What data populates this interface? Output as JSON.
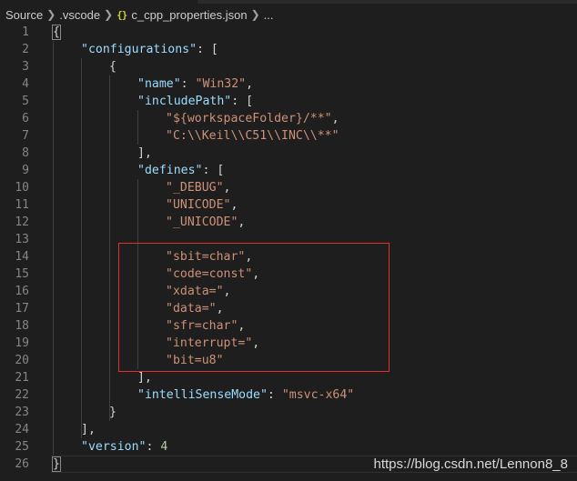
{
  "breadcrumb": {
    "items": [
      "Source",
      ".vscode",
      "c_cpp_properties.json",
      "..."
    ],
    "file_icon": "{}"
  },
  "editor": {
    "lines": [
      {
        "num": "1",
        "indent": 0,
        "tokens": [
          {
            "t": "p",
            "v": "{"
          }
        ]
      },
      {
        "num": "2",
        "indent": 1,
        "tokens": [
          {
            "t": "k",
            "v": "\"configurations\""
          },
          {
            "t": "p",
            "v": ": ["
          }
        ]
      },
      {
        "num": "3",
        "indent": 2,
        "tokens": [
          {
            "t": "p",
            "v": "{"
          }
        ]
      },
      {
        "num": "4",
        "indent": 3,
        "tokens": [
          {
            "t": "k",
            "v": "\"name\""
          },
          {
            "t": "p",
            "v": ": "
          },
          {
            "t": "s",
            "v": "\"Win32\""
          },
          {
            "t": "p",
            "v": ","
          }
        ]
      },
      {
        "num": "5",
        "indent": 3,
        "tokens": [
          {
            "t": "k",
            "v": "\"includePath\""
          },
          {
            "t": "p",
            "v": ": ["
          }
        ]
      },
      {
        "num": "6",
        "indent": 4,
        "tokens": [
          {
            "t": "s",
            "v": "\"${workspaceFolder}/**\""
          },
          {
            "t": "p",
            "v": ","
          }
        ]
      },
      {
        "num": "7",
        "indent": 4,
        "tokens": [
          {
            "t": "s",
            "v": "\"C:\\\\Keil\\\\C51\\\\INC\\\\**\""
          }
        ]
      },
      {
        "num": "8",
        "indent": 3,
        "tokens": [
          {
            "t": "p",
            "v": "],"
          }
        ]
      },
      {
        "num": "9",
        "indent": 3,
        "tokens": [
          {
            "t": "k",
            "v": "\"defines\""
          },
          {
            "t": "p",
            "v": ": ["
          }
        ]
      },
      {
        "num": "10",
        "indent": 4,
        "tokens": [
          {
            "t": "s",
            "v": "\"_DEBUG\""
          },
          {
            "t": "p",
            "v": ","
          }
        ]
      },
      {
        "num": "11",
        "indent": 4,
        "tokens": [
          {
            "t": "s",
            "v": "\"UNICODE\""
          },
          {
            "t": "p",
            "v": ","
          }
        ]
      },
      {
        "num": "12",
        "indent": 4,
        "tokens": [
          {
            "t": "s",
            "v": "\"_UNICODE\""
          },
          {
            "t": "p",
            "v": ","
          }
        ]
      },
      {
        "num": "13",
        "indent": 4,
        "tokens": []
      },
      {
        "num": "14",
        "indent": 4,
        "tokens": [
          {
            "t": "s",
            "v": "\"sbit=char\""
          },
          {
            "t": "p",
            "v": ","
          }
        ]
      },
      {
        "num": "15",
        "indent": 4,
        "tokens": [
          {
            "t": "s",
            "v": "\"code=const\""
          },
          {
            "t": "p",
            "v": ","
          }
        ]
      },
      {
        "num": "16",
        "indent": 4,
        "tokens": [
          {
            "t": "s",
            "v": "\"xdata=\""
          },
          {
            "t": "p",
            "v": ","
          }
        ]
      },
      {
        "num": "17",
        "indent": 4,
        "tokens": [
          {
            "t": "s",
            "v": "\"data=\""
          },
          {
            "t": "p",
            "v": ","
          }
        ]
      },
      {
        "num": "18",
        "indent": 4,
        "tokens": [
          {
            "t": "s",
            "v": "\"sfr=char\""
          },
          {
            "t": "p",
            "v": ","
          }
        ]
      },
      {
        "num": "19",
        "indent": 4,
        "tokens": [
          {
            "t": "s",
            "v": "\"interrupt=\""
          },
          {
            "t": "p",
            "v": ","
          }
        ]
      },
      {
        "num": "20",
        "indent": 4,
        "tokens": [
          {
            "t": "s",
            "v": "\"bit=u8\""
          }
        ]
      },
      {
        "num": "21",
        "indent": 3,
        "tokens": [
          {
            "t": "p",
            "v": "],"
          }
        ]
      },
      {
        "num": "22",
        "indent": 3,
        "tokens": [
          {
            "t": "k",
            "v": "\"intelliSenseMode\""
          },
          {
            "t": "p",
            "v": ": "
          },
          {
            "t": "s",
            "v": "\"msvc-x64\""
          }
        ]
      },
      {
        "num": "23",
        "indent": 2,
        "tokens": [
          {
            "t": "p",
            "v": "}"
          }
        ]
      },
      {
        "num": "24",
        "indent": 1,
        "tokens": [
          {
            "t": "p",
            "v": "],"
          }
        ]
      },
      {
        "num": "25",
        "indent": 1,
        "tokens": [
          {
            "t": "k",
            "v": "\"version\""
          },
          {
            "t": "p",
            "v": ": "
          },
          {
            "t": "n",
            "v": "4"
          }
        ]
      },
      {
        "num": "26",
        "indent": 0,
        "tokens": [
          {
            "t": "p",
            "v": "}"
          }
        ]
      }
    ],
    "current_line": "26"
  },
  "watermark": "https://blog.csdn.net/Lennon8_8",
  "colors": {
    "background": "#1e1e1e",
    "key": "#9cdcfe",
    "string": "#ce9178",
    "number": "#b5cea8",
    "punctuation": "#d4d4d4",
    "line_number": "#858585",
    "highlight_box": "#e0312b"
  }
}
